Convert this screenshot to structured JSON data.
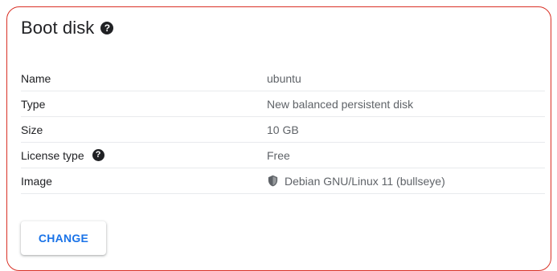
{
  "panel": {
    "title": "Boot disk",
    "help_icon": "help-circle-icon"
  },
  "rows": [
    {
      "label": "Name",
      "value": "ubuntu"
    },
    {
      "label": "Type",
      "value": "New balanced persistent disk"
    },
    {
      "label": "Size",
      "value": "10 GB"
    },
    {
      "label": "License type",
      "value": "Free",
      "help_icon": "help-circle-icon"
    },
    {
      "label": "Image",
      "value": "Debian GNU/Linux 11 (bullseye)",
      "icon": "shield-icon"
    }
  ],
  "actions": {
    "change_label": "CHANGE"
  },
  "colors": {
    "border": "#d93025",
    "accent": "#1a73e8",
    "text": "#202124",
    "muted": "#5f6368"
  }
}
